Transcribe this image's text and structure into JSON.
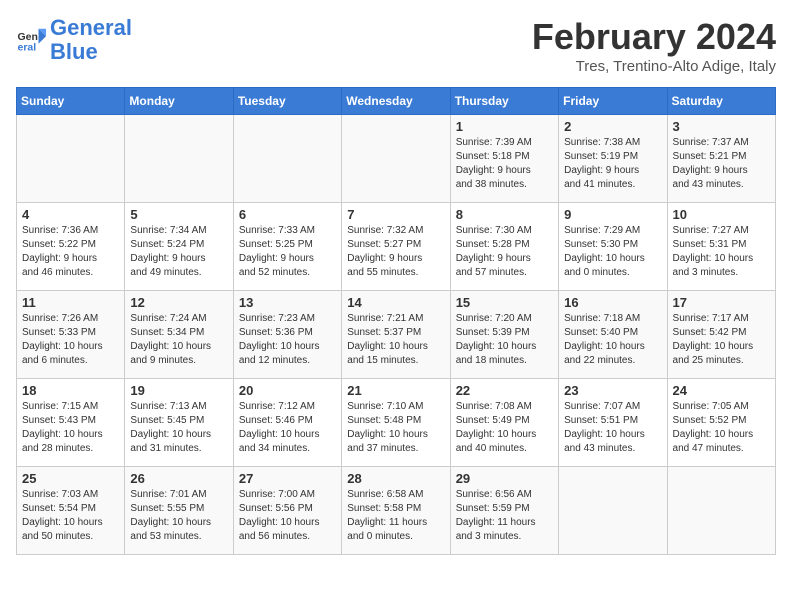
{
  "header": {
    "logo_line1": "General",
    "logo_line2": "Blue",
    "month_year": "February 2024",
    "location": "Tres, Trentino-Alto Adige, Italy"
  },
  "days_of_week": [
    "Sunday",
    "Monday",
    "Tuesday",
    "Wednesday",
    "Thursday",
    "Friday",
    "Saturday"
  ],
  "weeks": [
    [
      {
        "day": "",
        "info": ""
      },
      {
        "day": "",
        "info": ""
      },
      {
        "day": "",
        "info": ""
      },
      {
        "day": "",
        "info": ""
      },
      {
        "day": "1",
        "info": "Sunrise: 7:39 AM\nSunset: 5:18 PM\nDaylight: 9 hours\nand 38 minutes."
      },
      {
        "day": "2",
        "info": "Sunrise: 7:38 AM\nSunset: 5:19 PM\nDaylight: 9 hours\nand 41 minutes."
      },
      {
        "day": "3",
        "info": "Sunrise: 7:37 AM\nSunset: 5:21 PM\nDaylight: 9 hours\nand 43 minutes."
      }
    ],
    [
      {
        "day": "4",
        "info": "Sunrise: 7:36 AM\nSunset: 5:22 PM\nDaylight: 9 hours\nand 46 minutes."
      },
      {
        "day": "5",
        "info": "Sunrise: 7:34 AM\nSunset: 5:24 PM\nDaylight: 9 hours\nand 49 minutes."
      },
      {
        "day": "6",
        "info": "Sunrise: 7:33 AM\nSunset: 5:25 PM\nDaylight: 9 hours\nand 52 minutes."
      },
      {
        "day": "7",
        "info": "Sunrise: 7:32 AM\nSunset: 5:27 PM\nDaylight: 9 hours\nand 55 minutes."
      },
      {
        "day": "8",
        "info": "Sunrise: 7:30 AM\nSunset: 5:28 PM\nDaylight: 9 hours\nand 57 minutes."
      },
      {
        "day": "9",
        "info": "Sunrise: 7:29 AM\nSunset: 5:30 PM\nDaylight: 10 hours\nand 0 minutes."
      },
      {
        "day": "10",
        "info": "Sunrise: 7:27 AM\nSunset: 5:31 PM\nDaylight: 10 hours\nand 3 minutes."
      }
    ],
    [
      {
        "day": "11",
        "info": "Sunrise: 7:26 AM\nSunset: 5:33 PM\nDaylight: 10 hours\nand 6 minutes."
      },
      {
        "day": "12",
        "info": "Sunrise: 7:24 AM\nSunset: 5:34 PM\nDaylight: 10 hours\nand 9 minutes."
      },
      {
        "day": "13",
        "info": "Sunrise: 7:23 AM\nSunset: 5:36 PM\nDaylight: 10 hours\nand 12 minutes."
      },
      {
        "day": "14",
        "info": "Sunrise: 7:21 AM\nSunset: 5:37 PM\nDaylight: 10 hours\nand 15 minutes."
      },
      {
        "day": "15",
        "info": "Sunrise: 7:20 AM\nSunset: 5:39 PM\nDaylight: 10 hours\nand 18 minutes."
      },
      {
        "day": "16",
        "info": "Sunrise: 7:18 AM\nSunset: 5:40 PM\nDaylight: 10 hours\nand 22 minutes."
      },
      {
        "day": "17",
        "info": "Sunrise: 7:17 AM\nSunset: 5:42 PM\nDaylight: 10 hours\nand 25 minutes."
      }
    ],
    [
      {
        "day": "18",
        "info": "Sunrise: 7:15 AM\nSunset: 5:43 PM\nDaylight: 10 hours\nand 28 minutes."
      },
      {
        "day": "19",
        "info": "Sunrise: 7:13 AM\nSunset: 5:45 PM\nDaylight: 10 hours\nand 31 minutes."
      },
      {
        "day": "20",
        "info": "Sunrise: 7:12 AM\nSunset: 5:46 PM\nDaylight: 10 hours\nand 34 minutes."
      },
      {
        "day": "21",
        "info": "Sunrise: 7:10 AM\nSunset: 5:48 PM\nDaylight: 10 hours\nand 37 minutes."
      },
      {
        "day": "22",
        "info": "Sunrise: 7:08 AM\nSunset: 5:49 PM\nDaylight: 10 hours\nand 40 minutes."
      },
      {
        "day": "23",
        "info": "Sunrise: 7:07 AM\nSunset: 5:51 PM\nDaylight: 10 hours\nand 43 minutes."
      },
      {
        "day": "24",
        "info": "Sunrise: 7:05 AM\nSunset: 5:52 PM\nDaylight: 10 hours\nand 47 minutes."
      }
    ],
    [
      {
        "day": "25",
        "info": "Sunrise: 7:03 AM\nSunset: 5:54 PM\nDaylight: 10 hours\nand 50 minutes."
      },
      {
        "day": "26",
        "info": "Sunrise: 7:01 AM\nSunset: 5:55 PM\nDaylight: 10 hours\nand 53 minutes."
      },
      {
        "day": "27",
        "info": "Sunrise: 7:00 AM\nSunset: 5:56 PM\nDaylight: 10 hours\nand 56 minutes."
      },
      {
        "day": "28",
        "info": "Sunrise: 6:58 AM\nSunset: 5:58 PM\nDaylight: 11 hours\nand 0 minutes."
      },
      {
        "day": "29",
        "info": "Sunrise: 6:56 AM\nSunset: 5:59 PM\nDaylight: 11 hours\nand 3 minutes."
      },
      {
        "day": "",
        "info": ""
      },
      {
        "day": "",
        "info": ""
      }
    ]
  ]
}
